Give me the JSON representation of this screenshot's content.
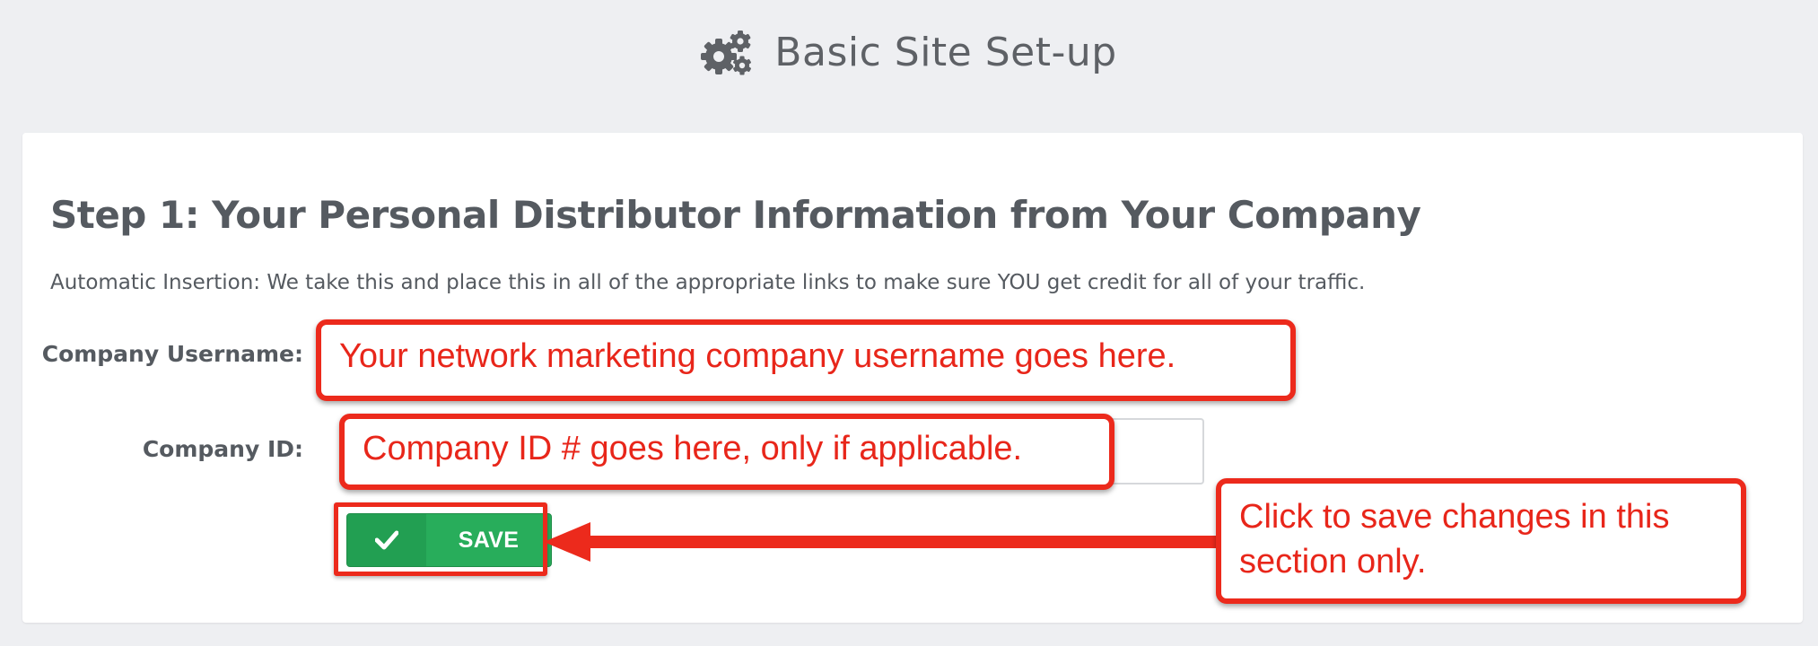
{
  "header": {
    "icon": "gears-icon",
    "title": "Basic Site Set-up"
  },
  "step": {
    "title": "Step 1: Your Personal Distributor Information from Your Company",
    "intro": "Automatic Insertion: We take this and place this in all of the appropriate links to make sure YOU get credit for all of your traffic."
  },
  "form": {
    "username_label": "Company Username:",
    "username_value": "",
    "id_label": "Company ID:",
    "id_value": "",
    "save_label": "SAVE",
    "save_icon": "check-icon"
  },
  "annotations": {
    "username_note": "Your network marketing company username goes here.",
    "id_note": "Company ID # goes here, only if applicable.",
    "save_note": "Click to save changes in this section only."
  },
  "colors": {
    "background": "#eeeff2",
    "text": "#555a60",
    "save_green": "#28ad5b",
    "callout_red": "#ec2a1c"
  }
}
